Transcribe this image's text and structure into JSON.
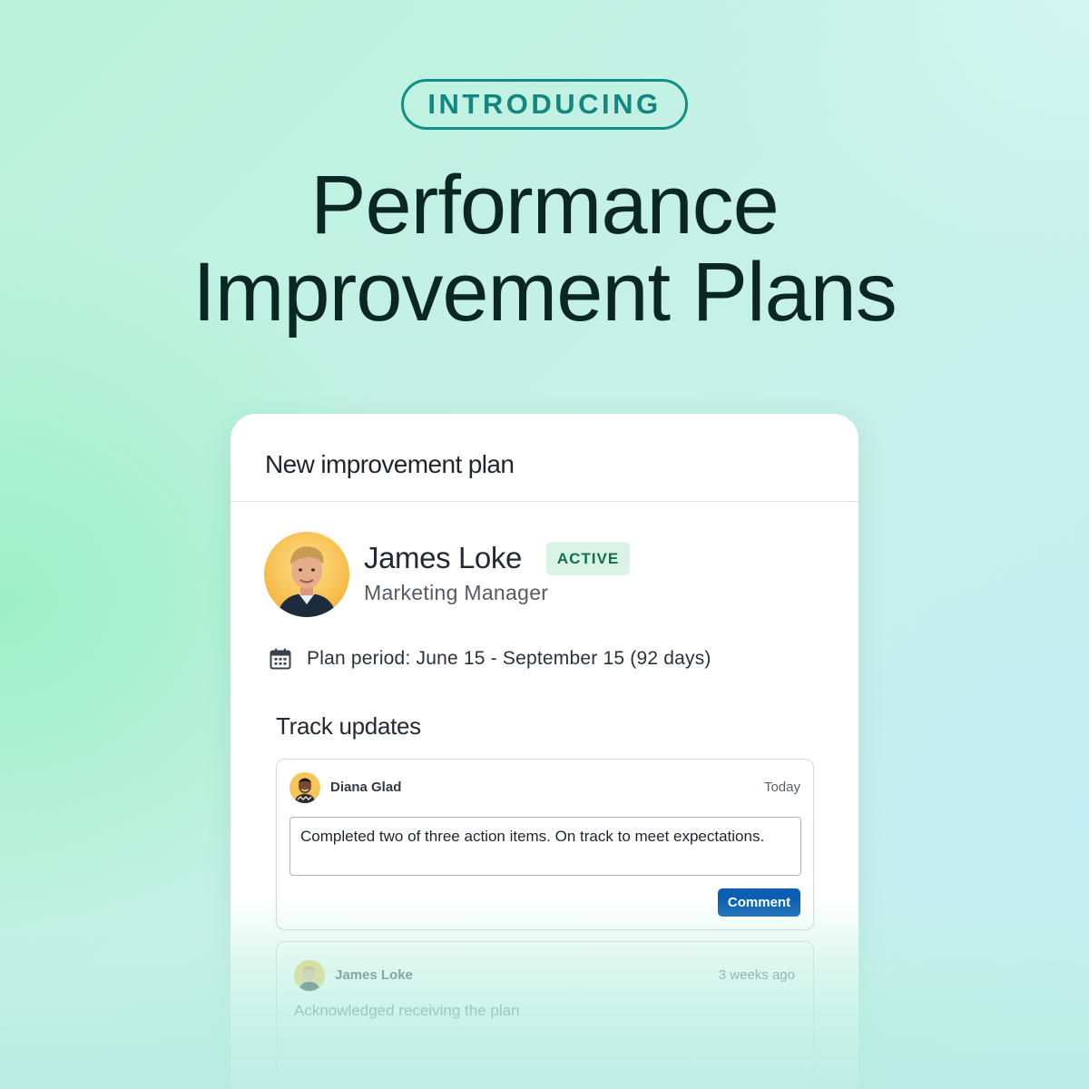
{
  "promo": {
    "pill_label": "INTRODUCING",
    "headline_line1": "Performance",
    "headline_line2": "Improvement Plans"
  },
  "card": {
    "title": "New improvement plan",
    "person": {
      "name": "James Loke",
      "status": "ACTIVE",
      "role": "Marketing Manager",
      "avatar_icon": "person-avatar"
    },
    "plan_period": "Plan period: June 15 - September 15 (92 days)",
    "plan_period_icon": "calendar-icon",
    "track_title": "Track updates",
    "updates": [
      {
        "author": "Diana Glad",
        "time": "Today",
        "text": "Completed two of three action items. On track to meet expectations.",
        "button": "Comment"
      },
      {
        "author": "James Loke",
        "time": "3 weeks ago",
        "text": "Acknowledged receiving the plan"
      }
    ]
  },
  "colors": {
    "accent_teal": "#13877f",
    "headline": "#0b2724",
    "badge_bg": "#d9f4e6",
    "badge_text": "#116f4e",
    "button_blue": "#0a5fb4"
  }
}
